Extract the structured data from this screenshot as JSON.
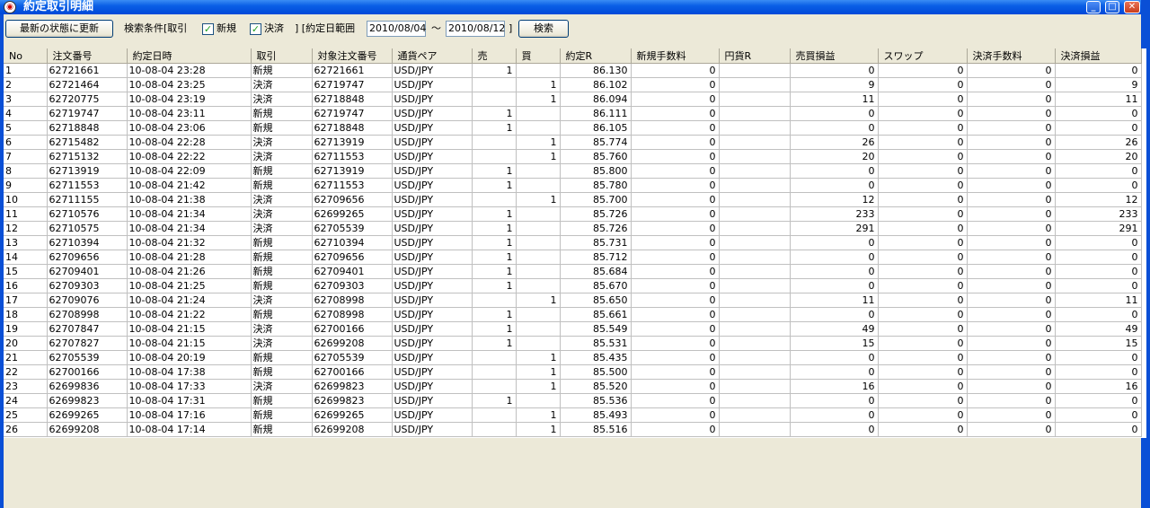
{
  "window": {
    "title": "約定取引明細",
    "app_icon": "app-icon",
    "min_icon": "_",
    "max_icon": "□",
    "close_icon": "✕"
  },
  "toolbar": {
    "refresh_label": "最新の状態に更新",
    "search_cond_label": "検索条件[取引",
    "new_checked": true,
    "new_label": "新規",
    "settle_checked": true,
    "settle_label": "決済",
    "date_range_label": "] [約定日範囲",
    "date_from": "2010/08/04",
    "tilde": "〜",
    "date_to": "2010/08/12",
    "close_bracket": "]",
    "search_label": "検索",
    "check_glyph": "✓"
  },
  "table": {
    "columns": [
      "No",
      "注文番号",
      "約定日時",
      "取引",
      "対象注文番号",
      "通貨ペア",
      "売",
      "買",
      "約定R",
      "新規手数料",
      "円貨R",
      "売買損益",
      "スワップ",
      "決済手数料",
      "決済損益"
    ],
    "rows": [
      [
        "1",
        "62721661",
        "10-08-04 23:28",
        "新規",
        "62721661",
        "USD/JPY",
        "1",
        "",
        "86.130",
        "0",
        "",
        "0",
        "0",
        "0",
        "0"
      ],
      [
        "2",
        "62721464",
        "10-08-04 23:25",
        "決済",
        "62719747",
        "USD/JPY",
        "",
        "1",
        "86.102",
        "0",
        "",
        "9",
        "0",
        "0",
        "9"
      ],
      [
        "3",
        "62720775",
        "10-08-04 23:19",
        "決済",
        "62718848",
        "USD/JPY",
        "",
        "1",
        "86.094",
        "0",
        "",
        "11",
        "0",
        "0",
        "11"
      ],
      [
        "4",
        "62719747",
        "10-08-04 23:11",
        "新規",
        "62719747",
        "USD/JPY",
        "1",
        "",
        "86.111",
        "0",
        "",
        "0",
        "0",
        "0",
        "0"
      ],
      [
        "5",
        "62718848",
        "10-08-04 23:06",
        "新規",
        "62718848",
        "USD/JPY",
        "1",
        "",
        "86.105",
        "0",
        "",
        "0",
        "0",
        "0",
        "0"
      ],
      [
        "6",
        "62715482",
        "10-08-04 22:28",
        "決済",
        "62713919",
        "USD/JPY",
        "",
        "1",
        "85.774",
        "0",
        "",
        "26",
        "0",
        "0",
        "26"
      ],
      [
        "7",
        "62715132",
        "10-08-04 22:22",
        "決済",
        "62711553",
        "USD/JPY",
        "",
        "1",
        "85.760",
        "0",
        "",
        "20",
        "0",
        "0",
        "20"
      ],
      [
        "8",
        "62713919",
        "10-08-04 22:09",
        "新規",
        "62713919",
        "USD/JPY",
        "1",
        "",
        "85.800",
        "0",
        "",
        "0",
        "0",
        "0",
        "0"
      ],
      [
        "9",
        "62711553",
        "10-08-04 21:42",
        "新規",
        "62711553",
        "USD/JPY",
        "1",
        "",
        "85.780",
        "0",
        "",
        "0",
        "0",
        "0",
        "0"
      ],
      [
        "10",
        "62711155",
        "10-08-04 21:38",
        "決済",
        "62709656",
        "USD/JPY",
        "",
        "1",
        "85.700",
        "0",
        "",
        "12",
        "0",
        "0",
        "12"
      ],
      [
        "11",
        "62710576",
        "10-08-04 21:34",
        "決済",
        "62699265",
        "USD/JPY",
        "1",
        "",
        "85.726",
        "0",
        "",
        "233",
        "0",
        "0",
        "233"
      ],
      [
        "12",
        "62710575",
        "10-08-04 21:34",
        "決済",
        "62705539",
        "USD/JPY",
        "1",
        "",
        "85.726",
        "0",
        "",
        "291",
        "0",
        "0",
        "291"
      ],
      [
        "13",
        "62710394",
        "10-08-04 21:32",
        "新規",
        "62710394",
        "USD/JPY",
        "1",
        "",
        "85.731",
        "0",
        "",
        "0",
        "0",
        "0",
        "0"
      ],
      [
        "14",
        "62709656",
        "10-08-04 21:28",
        "新規",
        "62709656",
        "USD/JPY",
        "1",
        "",
        "85.712",
        "0",
        "",
        "0",
        "0",
        "0",
        "0"
      ],
      [
        "15",
        "62709401",
        "10-08-04 21:26",
        "新規",
        "62709401",
        "USD/JPY",
        "1",
        "",
        "85.684",
        "0",
        "",
        "0",
        "0",
        "0",
        "0"
      ],
      [
        "16",
        "62709303",
        "10-08-04 21:25",
        "新規",
        "62709303",
        "USD/JPY",
        "1",
        "",
        "85.670",
        "0",
        "",
        "0",
        "0",
        "0",
        "0"
      ],
      [
        "17",
        "62709076",
        "10-08-04 21:24",
        "決済",
        "62708998",
        "USD/JPY",
        "",
        "1",
        "85.650",
        "0",
        "",
        "11",
        "0",
        "0",
        "11"
      ],
      [
        "18",
        "62708998",
        "10-08-04 21:22",
        "新規",
        "62708998",
        "USD/JPY",
        "1",
        "",
        "85.661",
        "0",
        "",
        "0",
        "0",
        "0",
        "0"
      ],
      [
        "19",
        "62707847",
        "10-08-04 21:15",
        "決済",
        "62700166",
        "USD/JPY",
        "1",
        "",
        "85.549",
        "0",
        "",
        "49",
        "0",
        "0",
        "49"
      ],
      [
        "20",
        "62707827",
        "10-08-04 21:15",
        "決済",
        "62699208",
        "USD/JPY",
        "1",
        "",
        "85.531",
        "0",
        "",
        "15",
        "0",
        "0",
        "15"
      ],
      [
        "21",
        "62705539",
        "10-08-04 20:19",
        "新規",
        "62705539",
        "USD/JPY",
        "",
        "1",
        "85.435",
        "0",
        "",
        "0",
        "0",
        "0",
        "0"
      ],
      [
        "22",
        "62700166",
        "10-08-04 17:38",
        "新規",
        "62700166",
        "USD/JPY",
        "",
        "1",
        "85.500",
        "0",
        "",
        "0",
        "0",
        "0",
        "0"
      ],
      [
        "23",
        "62699836",
        "10-08-04 17:33",
        "決済",
        "62699823",
        "USD/JPY",
        "",
        "1",
        "85.520",
        "0",
        "",
        "16",
        "0",
        "0",
        "16"
      ],
      [
        "24",
        "62699823",
        "10-08-04 17:31",
        "新規",
        "62699823",
        "USD/JPY",
        "1",
        "",
        "85.536",
        "0",
        "",
        "0",
        "0",
        "0",
        "0"
      ],
      [
        "25",
        "62699265",
        "10-08-04 17:16",
        "新規",
        "62699265",
        "USD/JPY",
        "",
        "1",
        "85.493",
        "0",
        "",
        "0",
        "0",
        "0",
        "0"
      ],
      [
        "26",
        "62699208",
        "10-08-04 17:14",
        "新規",
        "62699208",
        "USD/JPY",
        "",
        "1",
        "85.516",
        "0",
        "",
        "0",
        "0",
        "0",
        "0"
      ]
    ]
  }
}
